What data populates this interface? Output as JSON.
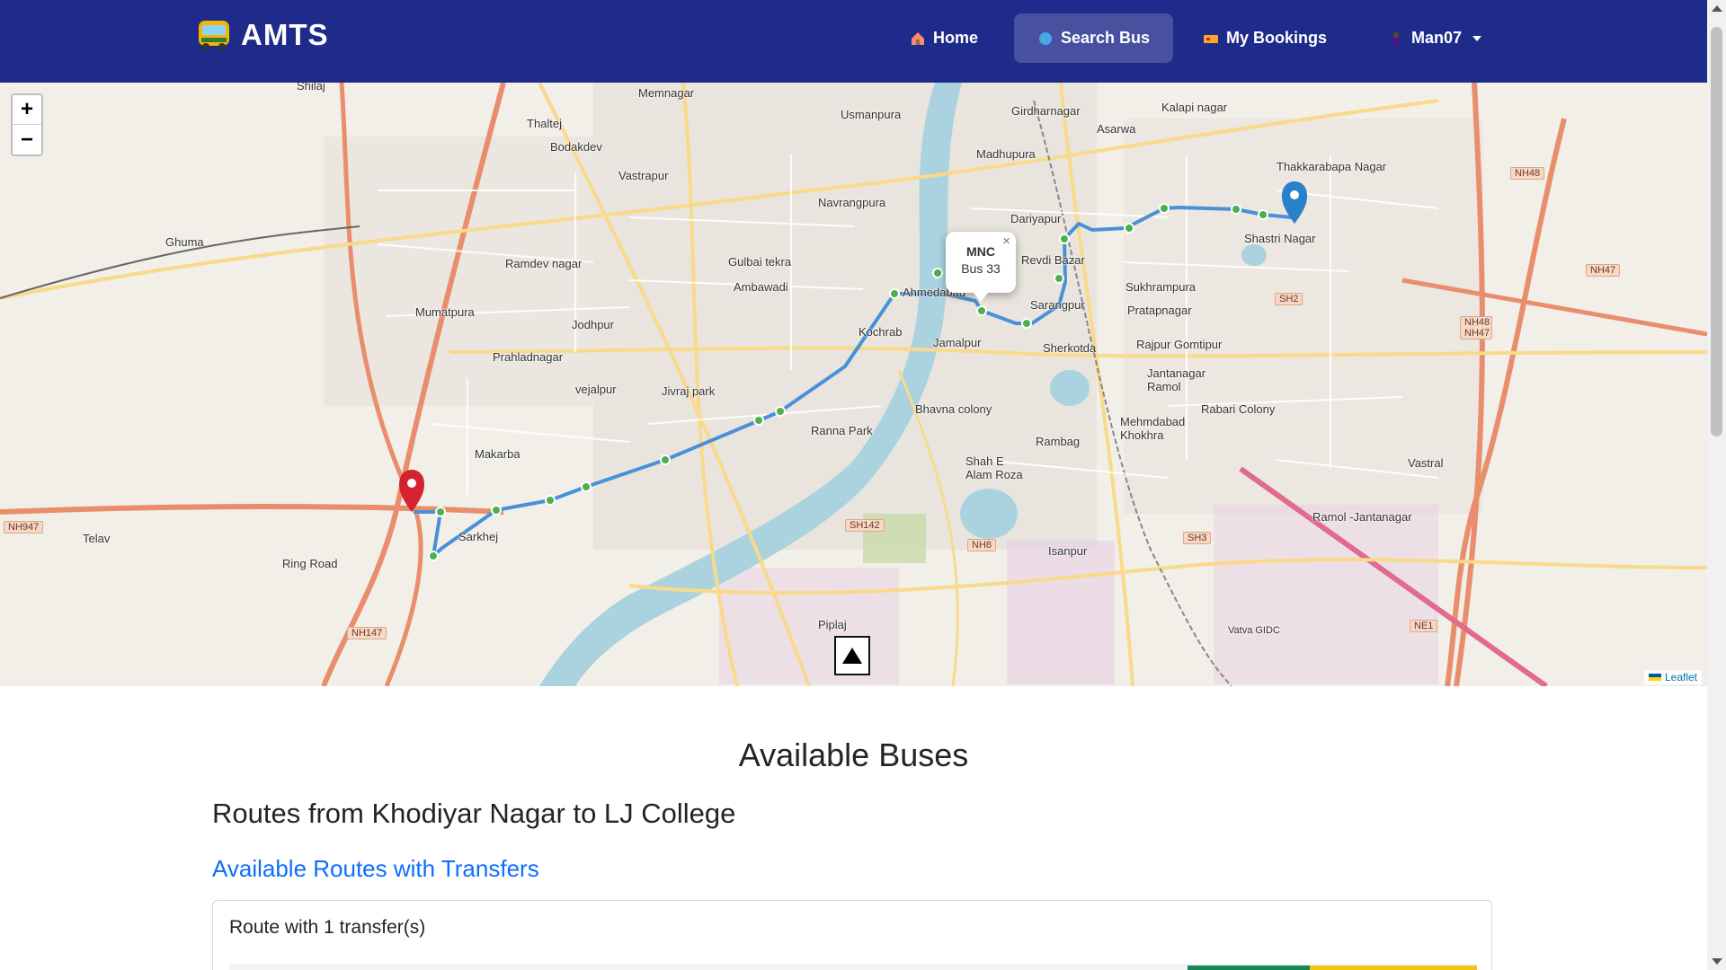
{
  "navbar": {
    "brand": "AMTS",
    "brand_icon": "bus-icon",
    "items": [
      {
        "label": "Home",
        "icon": "house-icon"
      },
      {
        "label": "Search Bus",
        "icon": "globe-icon",
        "active": true
      },
      {
        "label": "My Bookings",
        "icon": "ticket-icon"
      },
      {
        "label": "Man07",
        "icon": "person-icon",
        "dropdown": true
      }
    ],
    "background": "#1f2b8a"
  },
  "map": {
    "zoom_in": "+",
    "zoom_out": "−",
    "popup": {
      "title": "MNC",
      "subtitle": "Bus 33",
      "close": "×"
    },
    "attribution": "Leaflet",
    "route_color": "#4a90d9",
    "start_marker_color": "#d3232f",
    "end_marker_color": "#2a81cb",
    "labels": [
      "Shilaj",
      "Memnagar",
      "Thaltej",
      "Usmanpura",
      "Girdharnagar",
      "Kalapi nagar",
      "Asarwa",
      "Bodakdev",
      "Madhupura",
      "Vastrapur",
      "Thakkarabapa Nagar",
      "Navrangpura",
      "Dariyapur",
      "Shastri Nagar",
      "Ghuma",
      "Ramdev nagar",
      "Gulbai tekra",
      "Ambawadi",
      "Ahmedabad",
      "Revdi Bazar",
      "Sukhrampura",
      "Sarangpur",
      "Pratapnagar",
      "Mumatpura",
      "Jodhpur",
      "Kochrab",
      "Prahladnagar",
      "Jamalpur",
      "Sherkotda",
      "Rajpur Gomtipur",
      "Jantanagar Ramol",
      "vejalpur",
      "Jivraj park",
      "Rabari Colony",
      "Bhavna colony",
      "Ranna Park",
      "Mehmdabad Khokhra",
      "Rambag",
      "Makarba",
      "Vastral",
      "Shah E Alam Roza",
      "Sarkhej",
      "Telav",
      "Isanpur",
      "Ramol -Jantanagar",
      "Ring Road",
      "Piplaj",
      "Vatva GIDC"
    ],
    "shields": [
      "NH947",
      "NH147",
      "SH142",
      "NH8",
      "SH3",
      "SH2",
      "NH47",
      "NH48",
      "NH48 NH47",
      "NE1"
    ]
  },
  "content": {
    "heading": "Available Buses",
    "route_title": "Routes from Khodiyar Nagar to LJ College",
    "routes_link": "Available Routes with Transfers",
    "card_title": "Route with 1 transfer(s)"
  }
}
